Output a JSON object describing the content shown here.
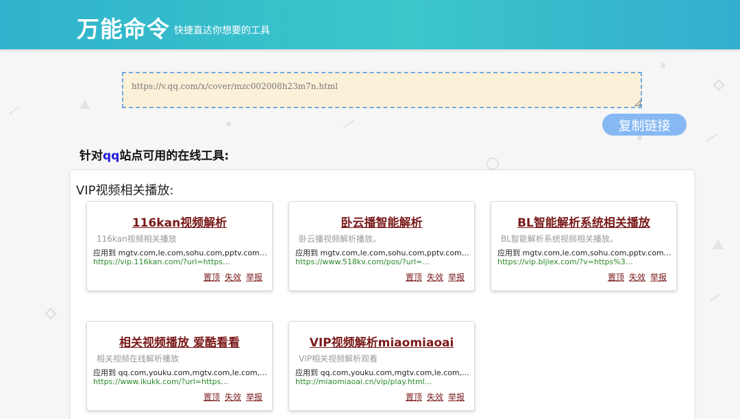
{
  "header": {
    "brand": "万能命令",
    "slogan": "快捷直达你想要的工具"
  },
  "url_input": {
    "value": "https://v.qq.com/x/cover/mzc002008h23m7n.html"
  },
  "copy_button": {
    "label": "复制链接"
  },
  "section_heading": {
    "prefix": "针对",
    "site": "qq",
    "suffix": "站点可用的在线工具:"
  },
  "panel": {
    "title": "VIP视频相关播放:",
    "cards": [
      {
        "title": "116kan视频解析",
        "desc": "116kan视频相关播放",
        "apply": "应用到 mgtv.com,le.com,sohu.com,pptv.com,...",
        "url": "https://vip.116kan.com/?url=https...",
        "actions": [
          "置顶",
          "失效",
          "举报"
        ]
      },
      {
        "title": "卧云播智能解析",
        "desc": "卧云播视频解析播放。",
        "apply": "应用到 mgtv.com,le.com,sohu.com,pptv.com,...",
        "url": "https://www.518kv.com/pos/?url=...",
        "actions": [
          "置顶",
          "失效",
          "举报"
        ]
      },
      {
        "title": "BL智能解析系统相关播放",
        "desc": "BL智能解析系统视频相关播放。",
        "apply": "应用到 mgtv.com,le.com,sohu.com,pptv.com,...",
        "url": "https://vip.bljiex.com/?v=https%3A...",
        "actions": [
          "置顶",
          "失效",
          "举报"
        ]
      },
      {
        "title": "相关视频播放 爱酷看看",
        "desc": "相关视频在线解析播放",
        "apply": "应用到 qq.com,youku.com,mgtv.com,le.com,...",
        "url": "https://www.ikukk.com/?url=https...",
        "actions": [
          "置顶",
          "失效",
          "举报"
        ]
      },
      {
        "title": "VIP视频解析miaomiaoai",
        "desc": "VIP相关视频解析观看",
        "apply": "应用到 qq.com,youku.com,mgtv.com,le.com,...",
        "url": "http://miaomiaoai.cn/vip/play.html...",
        "actions": [
          "置顶",
          "失效",
          "举报"
        ]
      }
    ]
  }
}
